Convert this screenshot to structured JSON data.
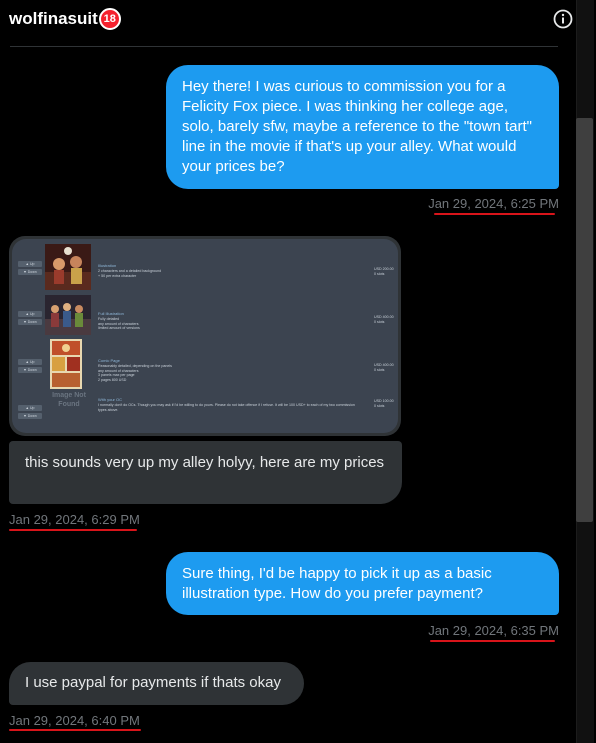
{
  "header": {
    "username": "wolfinasuit",
    "age_badge": "18",
    "info_icon": "info-circle-icon"
  },
  "messages": [
    {
      "id": "m1",
      "direction": "outgoing",
      "text": "Hey there! I was curious to commission you for a Felicity Fox piece. I was thinking her college age, solo, barely sfw, maybe a reference to the \"town tart\" line in the movie if that's up your alley. What would your prices be?",
      "timestamp": "Jan 29, 2024, 6:25 PM"
    },
    {
      "id": "m2",
      "direction": "incoming",
      "attachment": {
        "rows": [
          {
            "title": "Illustration",
            "description": [
              "2 characters and a detailed background",
              "+ 50 per extra character"
            ],
            "price": "USD 200.00",
            "slots": "0 slots",
            "up": "▲ Up",
            "down": "▼ Down"
          },
          {
            "title": "Full Illustration",
            "description": [
              "Fully detailed",
              "any amount of characters",
              "limited amount of versions"
            ],
            "price": "USD 400.00",
            "slots": "0 slots",
            "up": "▲ Up",
            "down": "▼ Down"
          },
          {
            "title": "Comic Page",
            "description": [
              "Reasonably detailed, depending on the panels",
              "any amount of characters",
              "3 panels max per page",
              "2 pages 800 USD"
            ],
            "price": "USD 400.00",
            "slots": "0 slots",
            "up": "▲ Up",
            "down": "▼ Down"
          },
          {
            "title": "With your OC",
            "description": [
              "I normally don't do OCs. Though you may ask if I'd be willing to do yours. Please do not take offence if I refuse. It will be 100 USD+ to each of my two commission",
              "types above."
            ],
            "price": "USD 100.00",
            "slots": "0 slots",
            "up": "▲ Up",
            "down": "▼ Down",
            "no_image": "Image Not Found"
          }
        ]
      },
      "text": "this sounds very up my alley holyy, here are my prices",
      "timestamp": "Jan 29, 2024, 6:29 PM"
    },
    {
      "id": "m3",
      "direction": "outgoing",
      "text": "Sure thing, I'd be happy to pick it up as a basic illustration type. How do you prefer payment?",
      "timestamp": "Jan 29, 2024, 6:35 PM"
    },
    {
      "id": "m4",
      "direction": "incoming",
      "text": "I use paypal for payments if thats okay",
      "timestamp": "Jan 29, 2024, 6:40 PM"
    }
  ],
  "colors": {
    "background": "#000000",
    "outgoing_bubble": "#1d9bf0",
    "incoming_bubble": "#2f3336",
    "timestamp": "#71767b",
    "annotation_underline": "#d8141a"
  }
}
